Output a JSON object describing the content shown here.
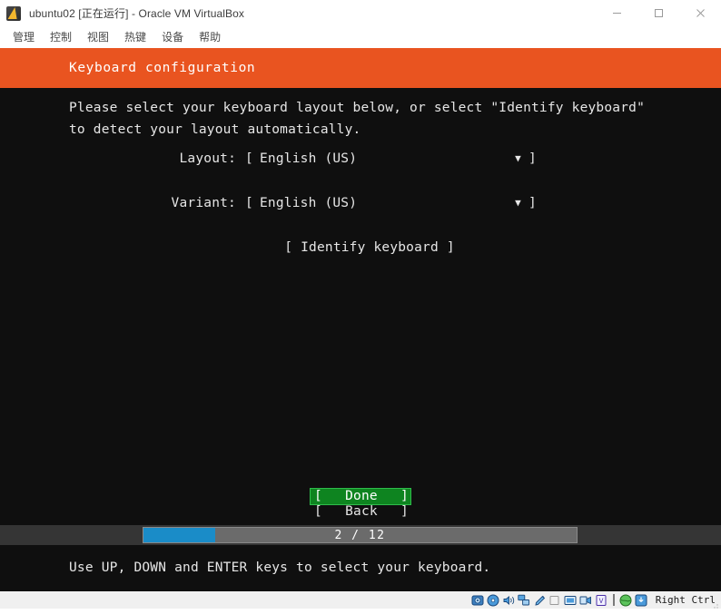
{
  "window": {
    "title": "ubuntu02 [正在运行] - Oracle VM VirtualBox",
    "icon": "virtualbox-icon",
    "controls": {
      "minimize": "minimize-button",
      "maximize": "maximize-button",
      "close": "close-button"
    }
  },
  "menubar": {
    "items": [
      {
        "label": "管理"
      },
      {
        "label": "控制"
      },
      {
        "label": "视图"
      },
      {
        "label": "热键"
      },
      {
        "label": "设备"
      },
      {
        "label": "帮助"
      }
    ]
  },
  "installer": {
    "header_title": "Keyboard configuration",
    "header_color": "#e95420",
    "intro_text": "Please select your keyboard layout below, or select \"Identify keyboard\" to detect your layout automatically.",
    "fields": [
      {
        "label": "Layout:",
        "open_bracket": "[",
        "value": "English (US)",
        "arrow": "▼",
        "close_bracket": "]"
      },
      {
        "label": "Variant:",
        "open_bracket": "[",
        "value": "English (US)",
        "arrow": "▼",
        "close_bracket": "]"
      }
    ],
    "identify_button": "[ Identify keyboard ]",
    "buttons": [
      {
        "open": "[",
        "label": "Done",
        "close": "]",
        "selected": true,
        "color": "#0e8420"
      },
      {
        "open": "[",
        "label": "Back",
        "close": "]",
        "selected": false
      }
    ],
    "progress": {
      "text": "2 / 12",
      "current": 2,
      "total": 12,
      "fill_color": "#1a8cc8",
      "track_color": "#6b6b6b"
    },
    "hint": "Use UP, DOWN and ENTER keys to select your keyboard."
  },
  "statusbar": {
    "icons": [
      "hard-disk-icon",
      "optical-disc-icon",
      "audio-icon",
      "network-icon",
      "usb-icon",
      "shared-folder-icon",
      "display-icon",
      "recording-icon",
      "virtualbox-guest-additions-icon",
      "mouse-integration-icon",
      "keyboard-capture-icon"
    ],
    "host_key": "Right Ctrl"
  }
}
